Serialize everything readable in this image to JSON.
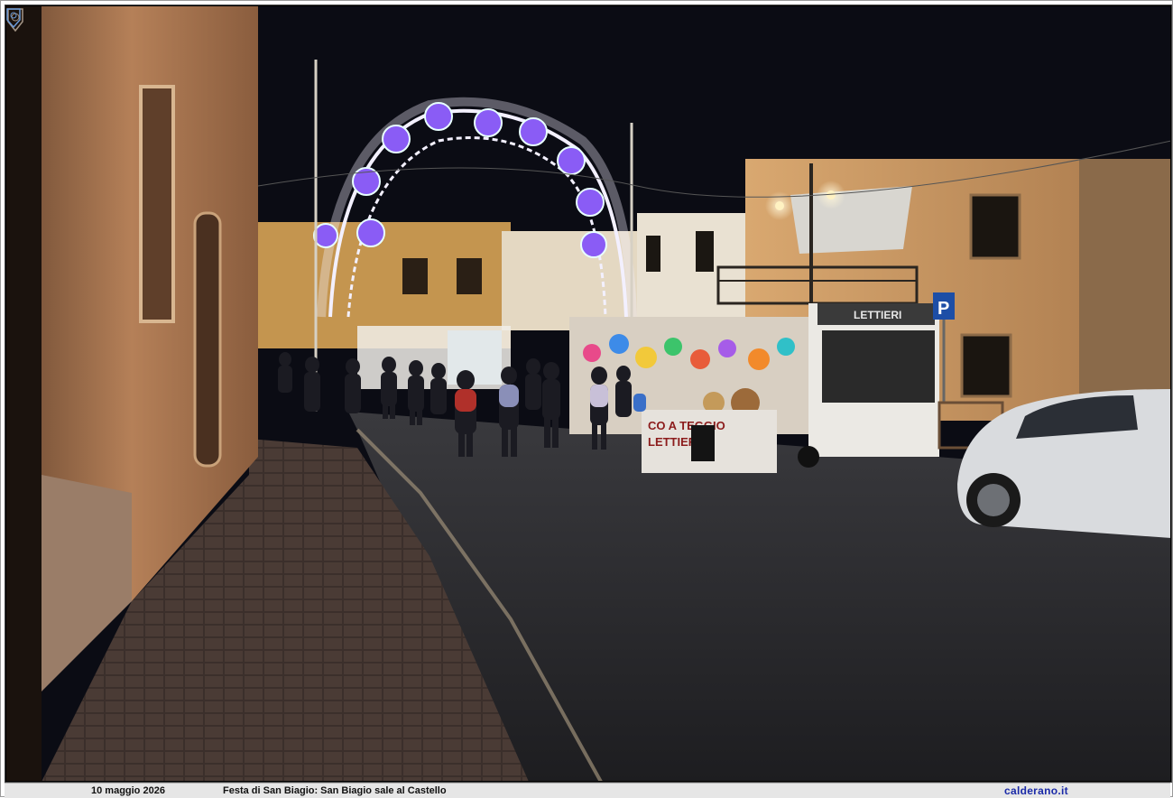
{
  "photo": {
    "description_alt": "Night street festival scene",
    "vendor_sign_truck": "LETTIERI",
    "vendor_sign_stall_line1": "CO A TEGGIO",
    "vendor_sign_stall_line2": "LETTIERI",
    "parking_sign": "P"
  },
  "caption": {
    "date": "10 maggio 2026",
    "title": "Festa di San Biagio: San Biagio sale al Castello",
    "site": "calderano.it"
  },
  "colors": {
    "sky": "#0b0c14",
    "road": "#2b2a2d",
    "sidewalk": "#3a2e2a",
    "wall_left": "#b07a52",
    "building_right": "#c79660",
    "lights": "#f3f0ff"
  }
}
